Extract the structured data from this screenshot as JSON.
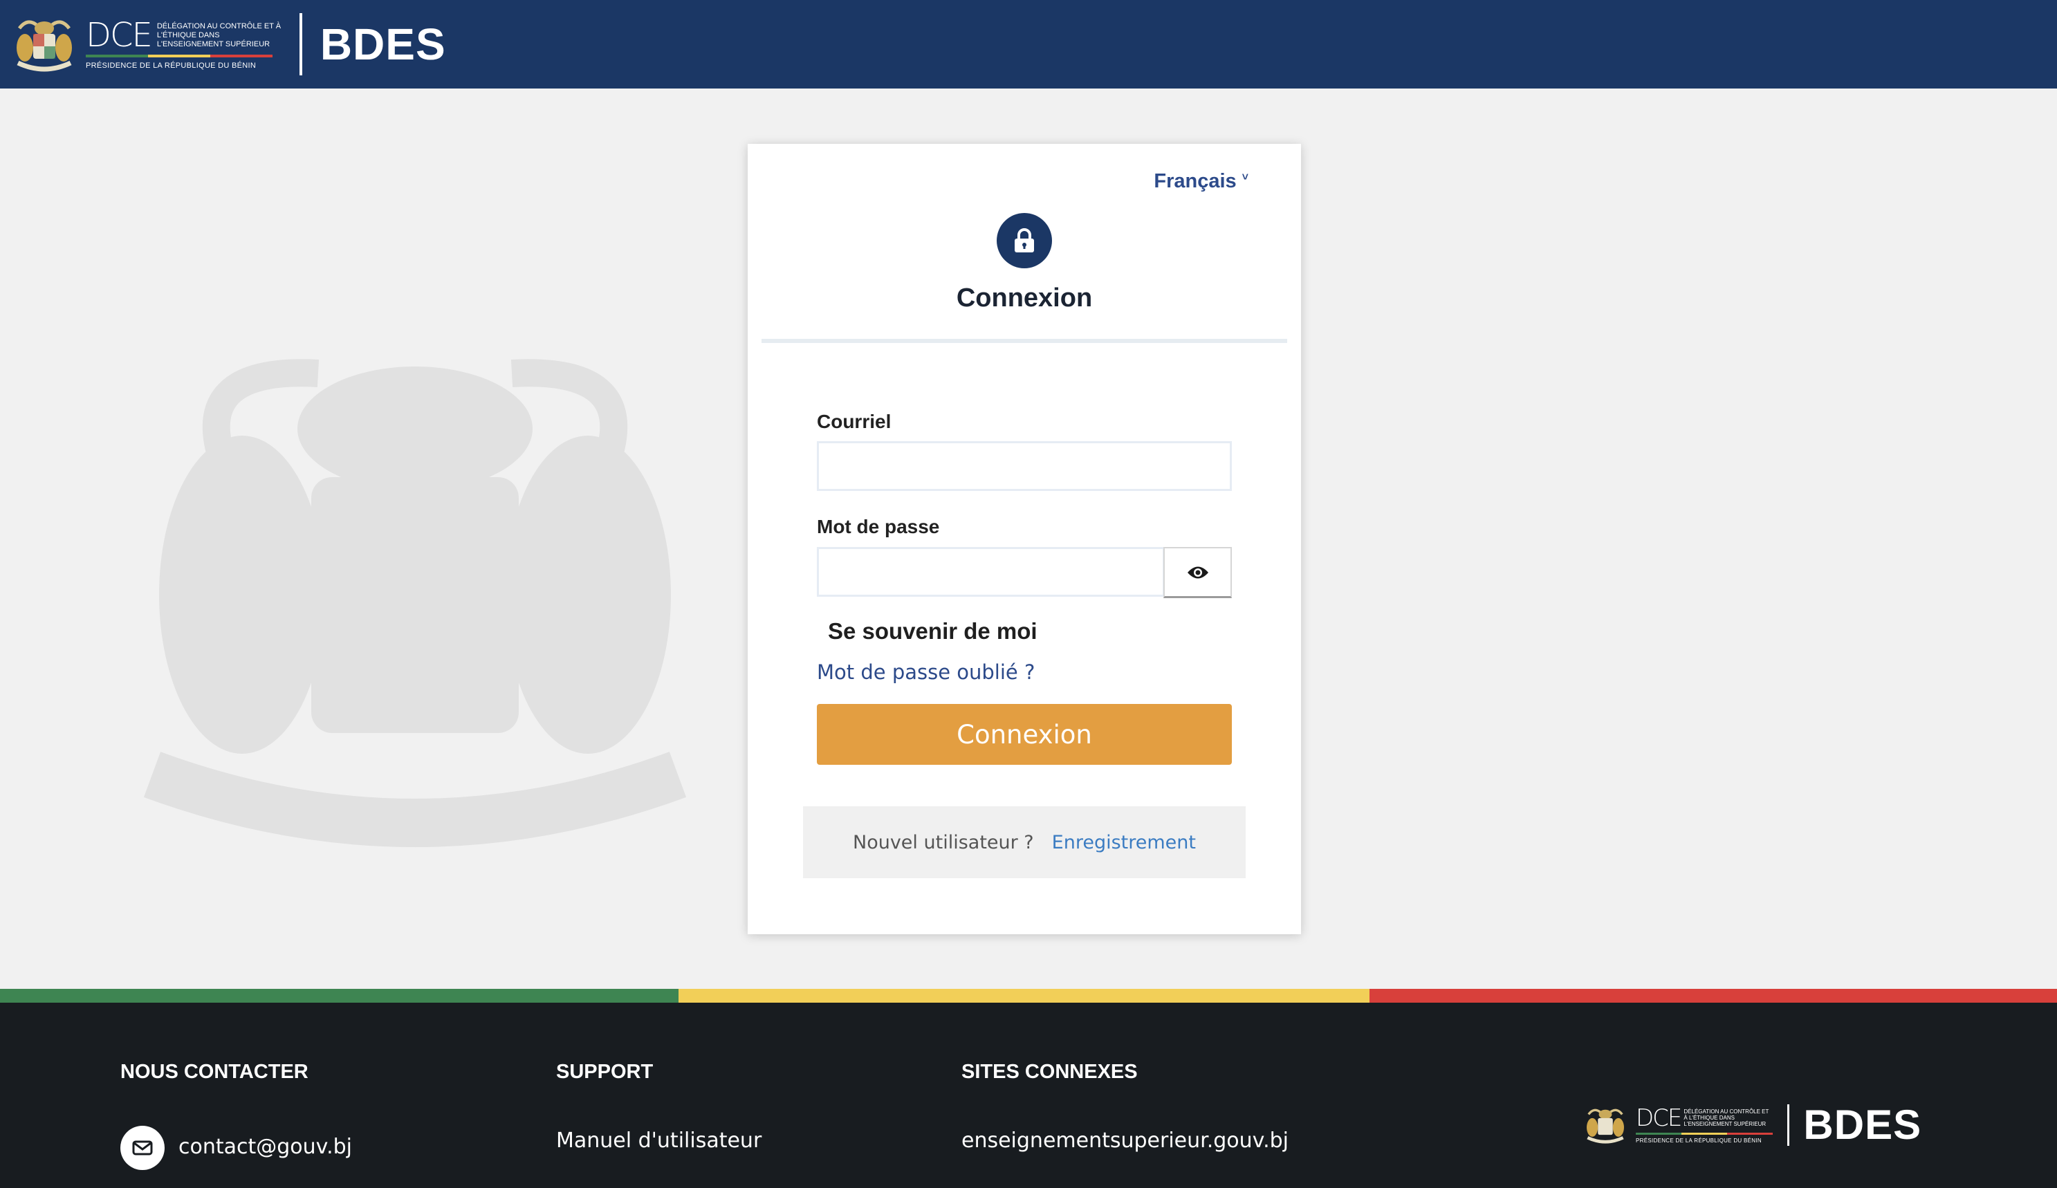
{
  "header": {
    "dce_mark": "DCE",
    "dce_desc": "Délégation au contrôle et à l'éthique dans l'enseignement supérieur",
    "dce_sub": "Présidence de la République du Bénin",
    "title": "BDES"
  },
  "login": {
    "language": "Français",
    "title": "Connexion",
    "email_label": "Courriel",
    "email_value": "",
    "password_label": "Mot de passe",
    "password_value": "",
    "remember_label": "Se souvenir de moi",
    "forgot_link": "Mot de passe oublié ?",
    "submit_label": "Connexion",
    "new_user_text": "Nouvel utilisateur ?",
    "register_link": "Enregistrement"
  },
  "footer": {
    "contact_heading": "NOUS CONTACTER",
    "contact_email": "contact@gouv.bj",
    "support_heading": "SUPPORT",
    "support_links": [
      "Manuel d'utilisateur"
    ],
    "related_heading": "SITES CONNEXES",
    "related_links": [
      "enseignementsuperieur.gouv.bj"
    ],
    "logo_title": "BDES"
  },
  "colors": {
    "header_bg": "#1b3765",
    "accent_button": "#e39e41",
    "link": "#2c4a8a",
    "flag_green": "#3e8552",
    "flag_yellow": "#f2cf58",
    "flag_red": "#d8403b",
    "footer_bg": "#181c20"
  },
  "icons": {
    "lock": "lock-icon",
    "eye": "eye-icon",
    "mail": "mail-icon",
    "language_chevron": "chevron-down-icon"
  }
}
